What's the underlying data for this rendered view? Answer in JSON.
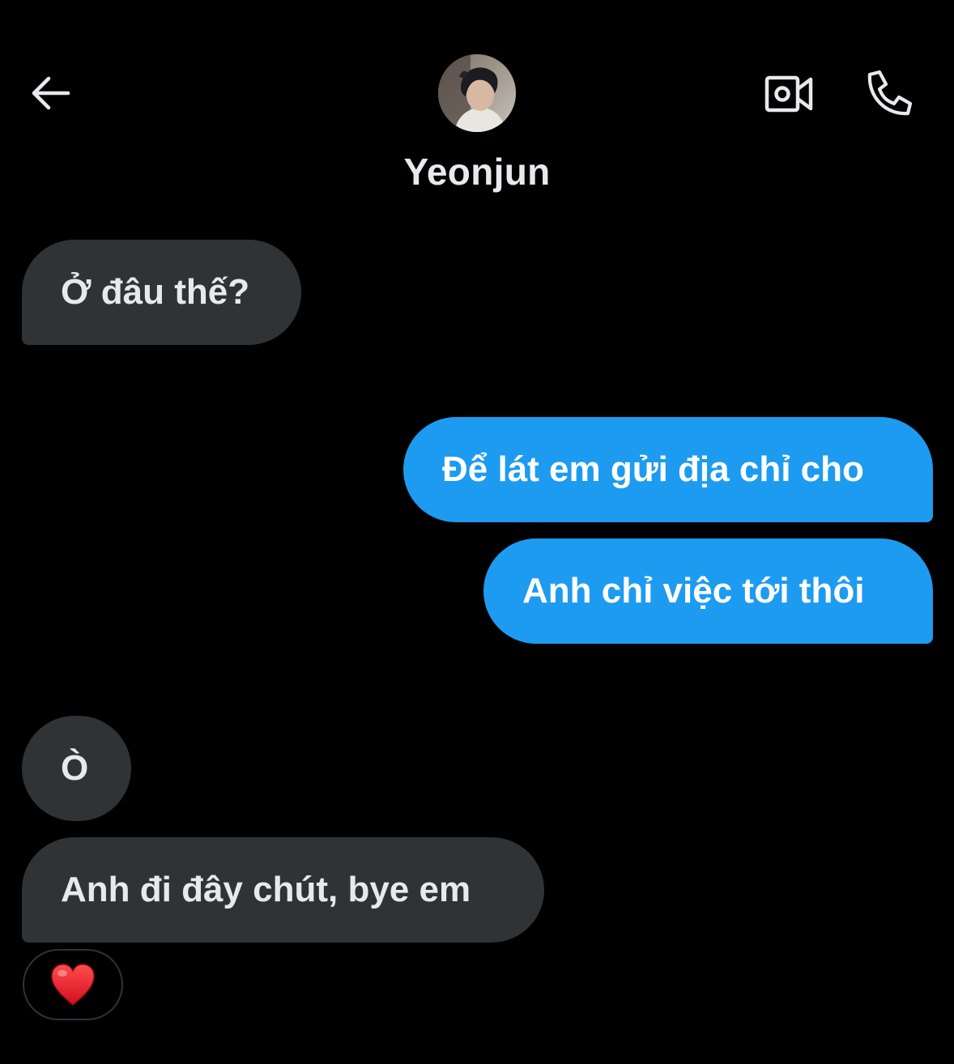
{
  "header": {
    "contact_name": "Yeonjun",
    "back_icon": "arrow-left-icon",
    "video_icon": "video-camera-icon",
    "call_icon": "phone-icon"
  },
  "colors": {
    "background": "#000000",
    "incoming_bubble": "#2f3336",
    "outgoing_bubble": "#1d9bf0",
    "text": "#e7e9ea"
  },
  "messages": [
    {
      "sender": "contact",
      "text": "Ở đâu thế?"
    },
    {
      "sender": "me",
      "text": "Để lát em gửi địa chỉ cho"
    },
    {
      "sender": "me",
      "text": "Anh chỉ việc tới thôi"
    },
    {
      "sender": "contact",
      "text": "Ò"
    },
    {
      "sender": "contact",
      "text": "Anh đi đây chút, bye em"
    }
  ],
  "reaction": {
    "emoji": "❤️",
    "icon": "red-heart-icon"
  }
}
